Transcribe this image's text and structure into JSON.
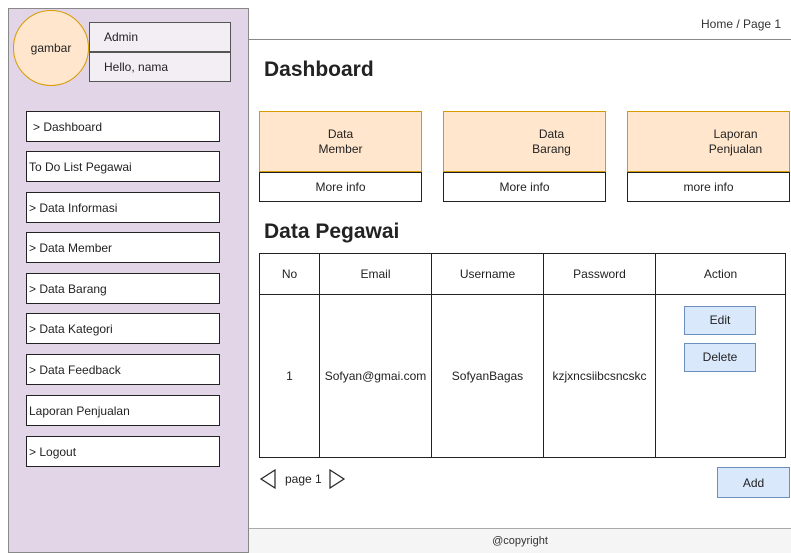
{
  "user": {
    "avatar_label": "gambar",
    "name": "Admin",
    "greeting": "Hello, nama"
  },
  "sidebar": {
    "items": [
      {
        "label": "> Dashboard"
      },
      {
        "label": "To Do List Pegawai"
      },
      {
        "label": "> Data Informasi"
      },
      {
        "label": "> Data Member"
      },
      {
        "label": "> Data Barang"
      },
      {
        "label": "> Data Kategori"
      },
      {
        "label": "> Data Feedback"
      },
      {
        "label": "Laporan Penjualan"
      },
      {
        "label": "> Logout"
      }
    ]
  },
  "header": {
    "breadcrumb": "Home / Page 1"
  },
  "main": {
    "title": "Dashboard",
    "cards": [
      {
        "line1": "Data",
        "line2": "Member",
        "link": "More info"
      },
      {
        "line1": "Data",
        "line2": "Barang",
        "link": "More info"
      },
      {
        "line1": "Laporan",
        "line2": "Penjualan",
        "link": "more info"
      }
    ],
    "section_title": "Data Pegawai",
    "table": {
      "headers": [
        "No",
        "Email",
        "Username",
        "Password",
        "Action"
      ],
      "rows": [
        {
          "no": "1",
          "email": "Sofyan@gmai.com",
          "username": "SofyanBagas",
          "password": "kzjxncsiibcsncskc",
          "edit": "Edit",
          "delete": "Delete"
        }
      ]
    },
    "pagination": {
      "label": "page 1"
    },
    "add_label": "Add"
  },
  "footer": {
    "text": "@copyright"
  },
  "colors": {
    "sidebar_bg": "#e1d5e7",
    "card_bg": "#ffe6cc",
    "card_border": "#d79b00",
    "button_bg": "#dae8fc",
    "button_border": "#6c8ebf"
  }
}
